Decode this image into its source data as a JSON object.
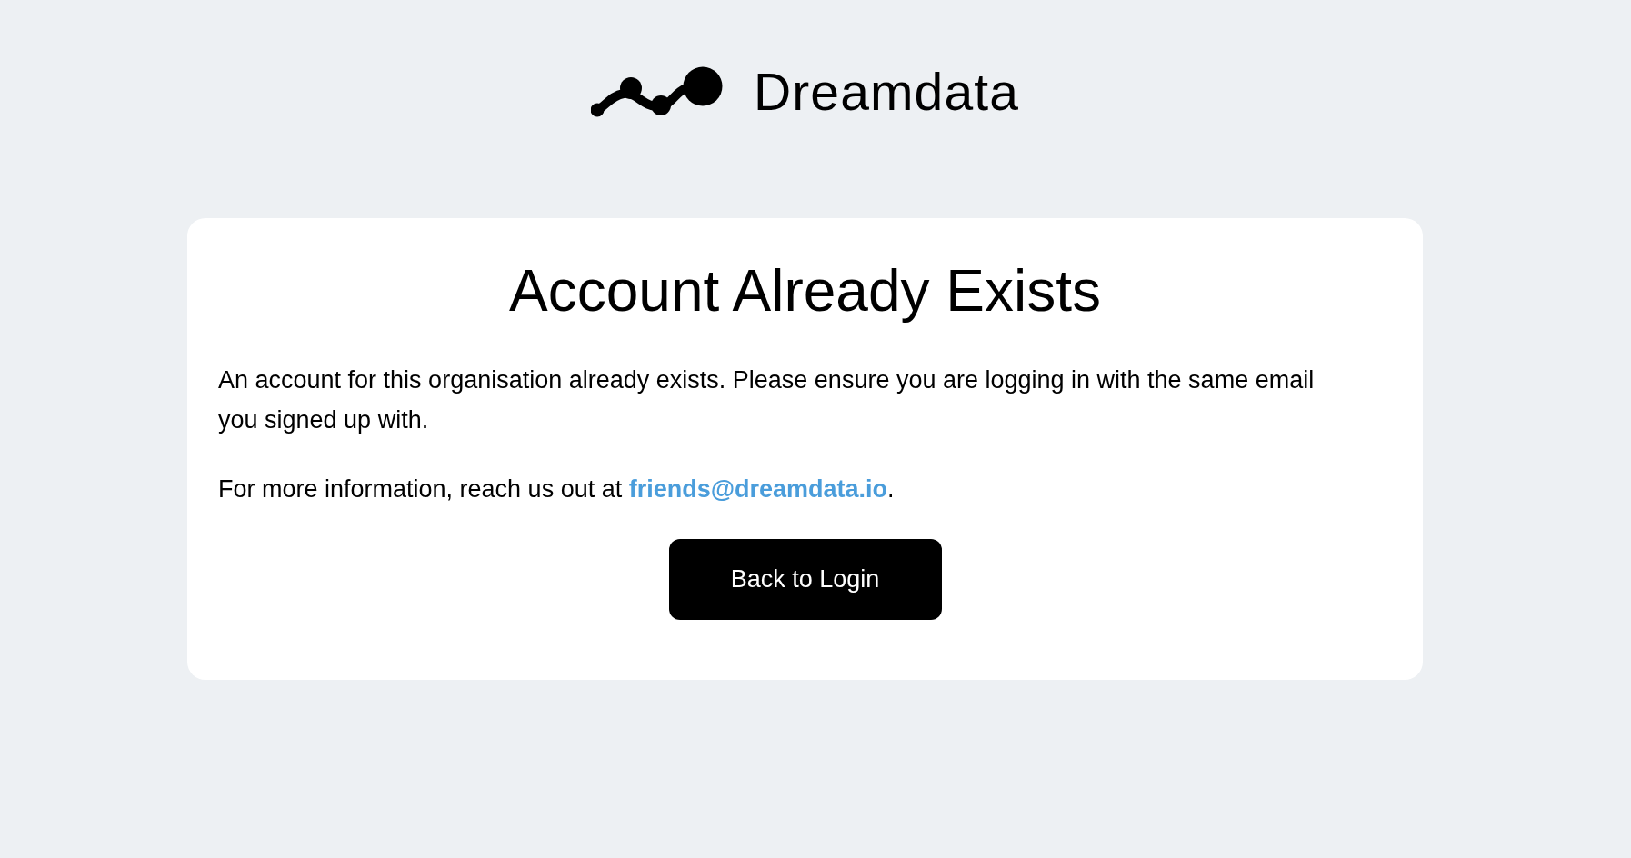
{
  "logo": {
    "wordmark": "Dreamdata"
  },
  "card": {
    "title": "Account Already Exists",
    "message": "An account for this organisation already exists. Please ensure you are logging in with the same email you signed up with.",
    "contact": {
      "text_before": "For more information, reach us out at ",
      "link": "friends@dreamdata.io",
      "text_after": "."
    },
    "button": "Back to Login"
  }
}
